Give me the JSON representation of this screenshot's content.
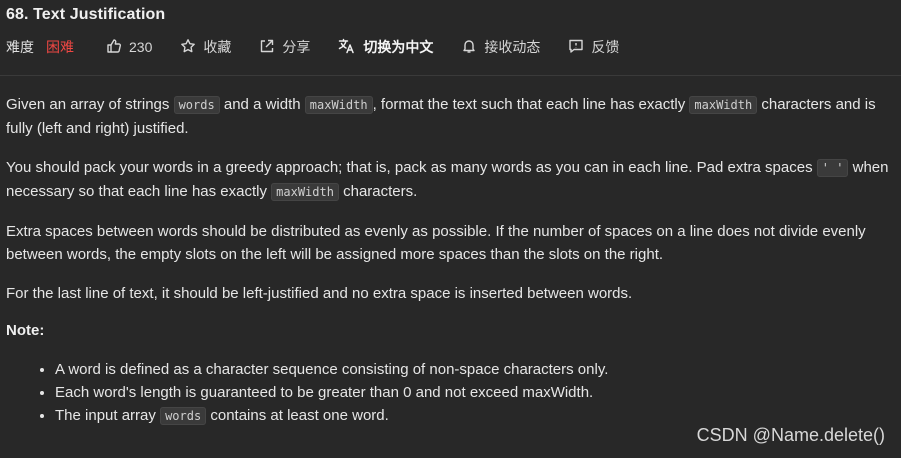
{
  "problem": {
    "title": "68. Text Justification"
  },
  "toolbar": {
    "difficulty_label": "难度",
    "difficulty_value": "困难",
    "likes": "230",
    "favorite_label": "收藏",
    "share_label": "分享",
    "translate_label": "切换为中文",
    "subscribe_label": "接收动态",
    "feedback_label": "反馈",
    "difficulty_color": "#ef4743",
    "icons": [
      "thumbs-up-icon",
      "star-icon",
      "share-icon",
      "translate-icon",
      "bell-icon",
      "feedback-icon"
    ]
  },
  "description": {
    "p1": {
      "t1": "Given an array of strings ",
      "c1": "words",
      "t2": " and a width ",
      "c2": "maxWidth",
      "t3": ", format the text such that each line has exactly ",
      "c3": "maxWidth",
      "t4": " characters and is fully (left and right) justified."
    },
    "p2": {
      "t1": "You should pack your words in a greedy approach; that is, pack as many words as you can in each line. Pad extra spaces ",
      "c1": "' '",
      "t2": " when necessary so that each line has exactly ",
      "c2": "maxWidth",
      "t3": " characters."
    },
    "p3": "Extra spaces between words should be distributed as evenly as possible. If the number of spaces on a line does not divide evenly between words, the empty slots on the left will be assigned more spaces than the slots on the right.",
    "p4": "For the last line of text, it should be left-justified and no extra space is inserted between words.",
    "note_label": "Note:",
    "notes": {
      "n1": "A word is defined as a character sequence consisting of non-space characters only.",
      "n2": "Each word's length is guaranteed to be greater than 0 and not exceed maxWidth.",
      "n3_t1": "The input array ",
      "n3_code": "words",
      "n3_t2": " contains at least one word."
    }
  },
  "watermark": "CSDN @Name.delete()"
}
